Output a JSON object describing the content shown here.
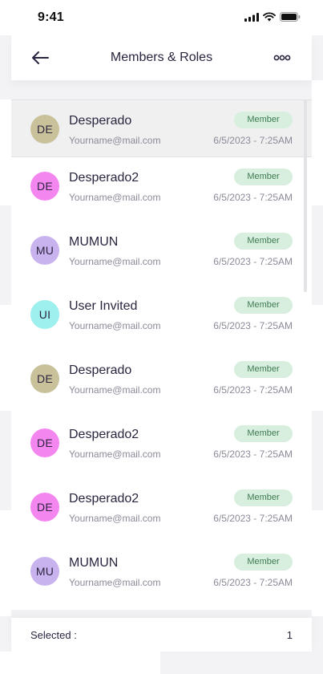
{
  "status_bar": {
    "time": "9:41"
  },
  "header": {
    "title": "Members & Roles"
  },
  "members": [
    {
      "initials": "DE",
      "name": "Desperado",
      "email": "Yourname@mail.com",
      "role": "Member",
      "date": "6/5/2023 - 7:25AM",
      "avatar_color": "#c9c19a",
      "selected": true
    },
    {
      "initials": "DE",
      "name": "Desperado2",
      "email": "Yourname@mail.com",
      "role": "Member",
      "date": "6/5/2023 - 7:25AM",
      "avatar_color": "#f486f0",
      "selected": false
    },
    {
      "initials": "MU",
      "name": "MUMUN",
      "email": "Yourname@mail.com",
      "role": "Member",
      "date": "6/5/2023 - 7:25AM",
      "avatar_color": "#c9b3ee",
      "selected": false
    },
    {
      "initials": "UI",
      "name": "User Invited",
      "email": "Yourname@mail.com",
      "role": "Member",
      "date": "6/5/2023 - 7:25AM",
      "avatar_color": "#9ef0ee",
      "selected": false
    },
    {
      "initials": "DE",
      "name": "Desperado",
      "email": "Yourname@mail.com",
      "role": "Member",
      "date": "6/5/2023 - 7:25AM",
      "avatar_color": "#c9c19a",
      "selected": false
    },
    {
      "initials": "DE",
      "name": "Desperado2",
      "email": "Yourname@mail.com",
      "role": "Member",
      "date": "6/5/2023 - 7:25AM",
      "avatar_color": "#f486f0",
      "selected": false
    },
    {
      "initials": "DE",
      "name": "Desperado2",
      "email": "Yourname@mail.com",
      "role": "Member",
      "date": "6/5/2023 - 7:25AM",
      "avatar_color": "#f486f0",
      "selected": false
    },
    {
      "initials": "MU",
      "name": "MUMUN",
      "email": "Yourname@mail.com",
      "role": "Member",
      "date": "6/5/2023 - 7:25AM",
      "avatar_color": "#c9b3ee",
      "selected": false
    }
  ],
  "footer": {
    "selected_label": "Selected :",
    "selected_count": "1"
  },
  "colors": {
    "badge_bg": "#d8efdf",
    "badge_text": "#3e7b52",
    "text_primary": "#2b2540",
    "text_secondary": "#8c8a98",
    "selected_row": "#f0f0f0"
  },
  "icons": {
    "back": "arrow-left-icon",
    "more": "more-dots-icon",
    "signal": "signal-icon",
    "wifi": "wifi-icon",
    "battery": "battery-icon"
  }
}
